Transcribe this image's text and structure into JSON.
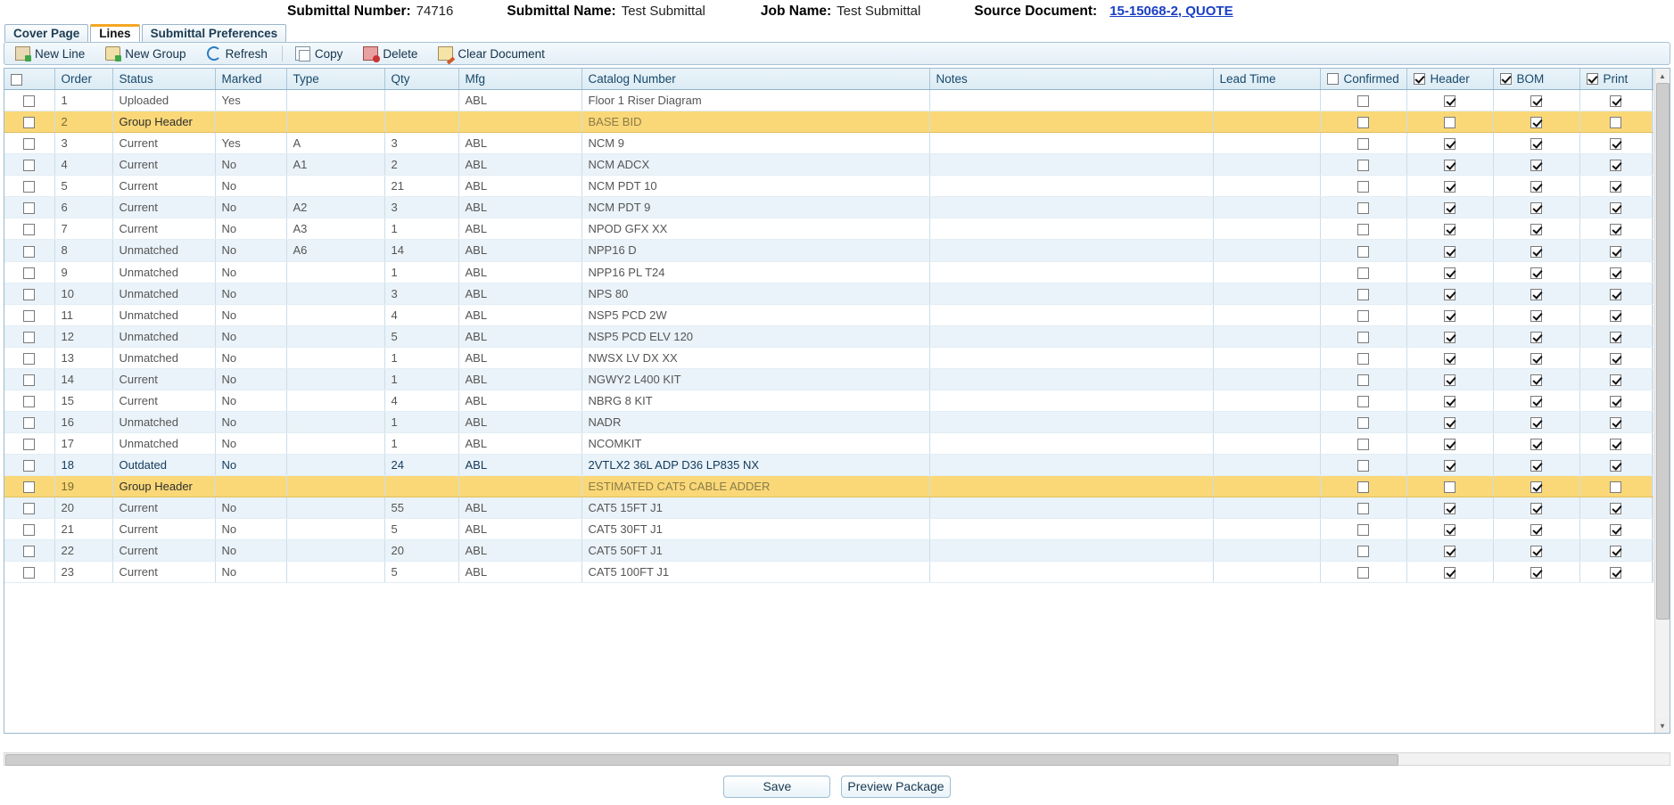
{
  "header": {
    "submittal_number_label": "Submittal Number:",
    "submittal_number_value": "74716",
    "submittal_name_label": "Submittal Name:",
    "submittal_name_value": "Test Submittal",
    "job_name_label": "Job Name:",
    "job_name_value": "Test Submittal",
    "source_document_label": "Source Document:",
    "source_document_link": "15-15068-2, QUOTE"
  },
  "tabs": [
    {
      "label": "Cover Page",
      "active": false
    },
    {
      "label": "Lines",
      "active": true
    },
    {
      "label": "Submittal Preferences",
      "active": false
    }
  ],
  "toolbar": {
    "new_line": "New Line",
    "new_group": "New Group",
    "refresh": "Refresh",
    "copy": "Copy",
    "delete": "Delete",
    "clear_document": "Clear Document"
  },
  "grid": {
    "columns": [
      "Order",
      "Status",
      "Marked",
      "Type",
      "Qty",
      "Mfg",
      "Catalog Number",
      "Notes",
      "Lead Time",
      "Confirmed",
      "Header",
      "BOM",
      "Print"
    ],
    "header_checkboxes": {
      "select_all": false,
      "confirmed": false,
      "header": true,
      "bom": true,
      "print": true
    },
    "rows": [
      {
        "sel": false,
        "order": "1",
        "status": "Uploaded",
        "marked": "Yes",
        "type": "",
        "qty": "",
        "mfg": "ABL",
        "catalog": "Floor 1 Riser Diagram",
        "notes": "",
        "lead": "",
        "confirmed": false,
        "hdr": true,
        "bom": true,
        "print": true,
        "kind": "normal"
      },
      {
        "sel": false,
        "order": "2",
        "status": "Group Header",
        "marked": "",
        "type": "",
        "qty": "",
        "mfg": "",
        "catalog": "BASE BID",
        "notes": "",
        "lead": "",
        "confirmed": false,
        "hdr": false,
        "bom": true,
        "print": false,
        "kind": "group"
      },
      {
        "sel": false,
        "order": "3",
        "status": "Current",
        "marked": "Yes",
        "type": "A",
        "qty": "3",
        "mfg": "ABL",
        "catalog": "NCM 9",
        "notes": "",
        "lead": "",
        "confirmed": false,
        "hdr": true,
        "bom": true,
        "print": true,
        "kind": "normal"
      },
      {
        "sel": false,
        "order": "4",
        "status": "Current",
        "marked": "No",
        "type": "A1",
        "qty": "2",
        "mfg": "ABL",
        "catalog": "NCM ADCX",
        "notes": "",
        "lead": "",
        "confirmed": false,
        "hdr": true,
        "bom": true,
        "print": true,
        "kind": "alt"
      },
      {
        "sel": false,
        "order": "5",
        "status": "Current",
        "marked": "No",
        "type": "",
        "qty": "21",
        "mfg": "ABL",
        "catalog": "NCM PDT 10",
        "notes": "",
        "lead": "",
        "confirmed": false,
        "hdr": true,
        "bom": true,
        "print": true,
        "kind": "normal"
      },
      {
        "sel": false,
        "order": "6",
        "status": "Current",
        "marked": "No",
        "type": "A2",
        "qty": "3",
        "mfg": "ABL",
        "catalog": "NCM PDT 9",
        "notes": "",
        "lead": "",
        "confirmed": false,
        "hdr": true,
        "bom": true,
        "print": true,
        "kind": "alt"
      },
      {
        "sel": false,
        "order": "7",
        "status": "Current",
        "marked": "No",
        "type": "A3",
        "qty": "1",
        "mfg": "ABL",
        "catalog": "NPOD GFX XX",
        "notes": "",
        "lead": "",
        "confirmed": false,
        "hdr": true,
        "bom": true,
        "print": true,
        "kind": "normal"
      },
      {
        "sel": false,
        "order": "8",
        "status": "Unmatched",
        "marked": "No",
        "type": "A6",
        "qty": "14",
        "mfg": "ABL",
        "catalog": "NPP16 D",
        "notes": "",
        "lead": "",
        "confirmed": false,
        "hdr": true,
        "bom": true,
        "print": true,
        "kind": "alt"
      },
      {
        "sel": false,
        "order": "9",
        "status": "Unmatched",
        "marked": "No",
        "type": "",
        "qty": "1",
        "mfg": "ABL",
        "catalog": "NPP16 PL T24",
        "notes": "",
        "lead": "",
        "confirmed": false,
        "hdr": true,
        "bom": true,
        "print": true,
        "kind": "normal"
      },
      {
        "sel": false,
        "order": "10",
        "status": "Unmatched",
        "marked": "No",
        "type": "",
        "qty": "3",
        "mfg": "ABL",
        "catalog": "NPS 80",
        "notes": "",
        "lead": "",
        "confirmed": false,
        "hdr": true,
        "bom": true,
        "print": true,
        "kind": "alt"
      },
      {
        "sel": false,
        "order": "11",
        "status": "Unmatched",
        "marked": "No",
        "type": "",
        "qty": "4",
        "mfg": "ABL",
        "catalog": "NSP5 PCD 2W",
        "notes": "",
        "lead": "",
        "confirmed": false,
        "hdr": true,
        "bom": true,
        "print": true,
        "kind": "normal"
      },
      {
        "sel": false,
        "order": "12",
        "status": "Unmatched",
        "marked": "No",
        "type": "",
        "qty": "5",
        "mfg": "ABL",
        "catalog": "NSP5 PCD ELV 120",
        "notes": "",
        "lead": "",
        "confirmed": false,
        "hdr": true,
        "bom": true,
        "print": true,
        "kind": "alt"
      },
      {
        "sel": false,
        "order": "13",
        "status": "Unmatched",
        "marked": "No",
        "type": "",
        "qty": "1",
        "mfg": "ABL",
        "catalog": "NWSX LV DX XX",
        "notes": "",
        "lead": "",
        "confirmed": false,
        "hdr": true,
        "bom": true,
        "print": true,
        "kind": "normal"
      },
      {
        "sel": false,
        "order": "14",
        "status": "Current",
        "marked": "No",
        "type": "",
        "qty": "1",
        "mfg": "ABL",
        "catalog": "NGWY2 L400 KIT",
        "notes": "",
        "lead": "",
        "confirmed": false,
        "hdr": true,
        "bom": true,
        "print": true,
        "kind": "alt"
      },
      {
        "sel": false,
        "order": "15",
        "status": "Current",
        "marked": "No",
        "type": "",
        "qty": "4",
        "mfg": "ABL",
        "catalog": "NBRG 8 KIT",
        "notes": "",
        "lead": "",
        "confirmed": false,
        "hdr": true,
        "bom": true,
        "print": true,
        "kind": "normal"
      },
      {
        "sel": false,
        "order": "16",
        "status": "Unmatched",
        "marked": "No",
        "type": "",
        "qty": "1",
        "mfg": "ABL",
        "catalog": "NADR",
        "notes": "",
        "lead": "",
        "confirmed": false,
        "hdr": true,
        "bom": true,
        "print": true,
        "kind": "alt"
      },
      {
        "sel": false,
        "order": "17",
        "status": "Unmatched",
        "marked": "No",
        "type": "",
        "qty": "1",
        "mfg": "ABL",
        "catalog": "NCOMKIT",
        "notes": "",
        "lead": "",
        "confirmed": false,
        "hdr": true,
        "bom": true,
        "print": true,
        "kind": "normal"
      },
      {
        "sel": false,
        "order": "18",
        "status": "Outdated",
        "marked": "No",
        "type": "",
        "qty": "24",
        "mfg": "ABL",
        "catalog": "2VTLX2 36L ADP D36 LP835 NX",
        "notes": "",
        "lead": "",
        "confirmed": false,
        "hdr": true,
        "bom": true,
        "print": true,
        "kind": "selected"
      },
      {
        "sel": false,
        "order": "19",
        "status": "Group Header",
        "marked": "",
        "type": "",
        "qty": "",
        "mfg": "",
        "catalog": "ESTIMATED CAT5 CABLE ADDER",
        "notes": "",
        "lead": "",
        "confirmed": false,
        "hdr": false,
        "bom": true,
        "print": false,
        "kind": "group"
      },
      {
        "sel": false,
        "order": "20",
        "status": "Current",
        "marked": "No",
        "type": "",
        "qty": "55",
        "mfg": "ABL",
        "catalog": "CAT5 15FT J1",
        "notes": "",
        "lead": "",
        "confirmed": false,
        "hdr": true,
        "bom": true,
        "print": true,
        "kind": "alt"
      },
      {
        "sel": false,
        "order": "21",
        "status": "Current",
        "marked": "No",
        "type": "",
        "qty": "5",
        "mfg": "ABL",
        "catalog": "CAT5 30FT J1",
        "notes": "",
        "lead": "",
        "confirmed": false,
        "hdr": true,
        "bom": true,
        "print": true,
        "kind": "normal"
      },
      {
        "sel": false,
        "order": "22",
        "status": "Current",
        "marked": "No",
        "type": "",
        "qty": "20",
        "mfg": "ABL",
        "catalog": "CAT5 50FT J1",
        "notes": "",
        "lead": "",
        "confirmed": false,
        "hdr": true,
        "bom": true,
        "print": true,
        "kind": "alt"
      },
      {
        "sel": false,
        "order": "23",
        "status": "Current",
        "marked": "No",
        "type": "",
        "qty": "5",
        "mfg": "ABL",
        "catalog": "CAT5 100FT J1",
        "notes": "",
        "lead": "",
        "confirmed": false,
        "hdr": true,
        "bom": true,
        "print": true,
        "kind": "normal"
      }
    ]
  },
  "footer": {
    "save": "Save",
    "preview_package": "Preview Package"
  },
  "colors": {
    "accent_tab": "#f5a623",
    "group_row": "#fad878",
    "link": "#1a3fc4",
    "status_current": "#127d2a",
    "status_unmatched": "#d8242a",
    "status_outdated": "#e8942a",
    "status_uploaded": "#1a43cc"
  }
}
